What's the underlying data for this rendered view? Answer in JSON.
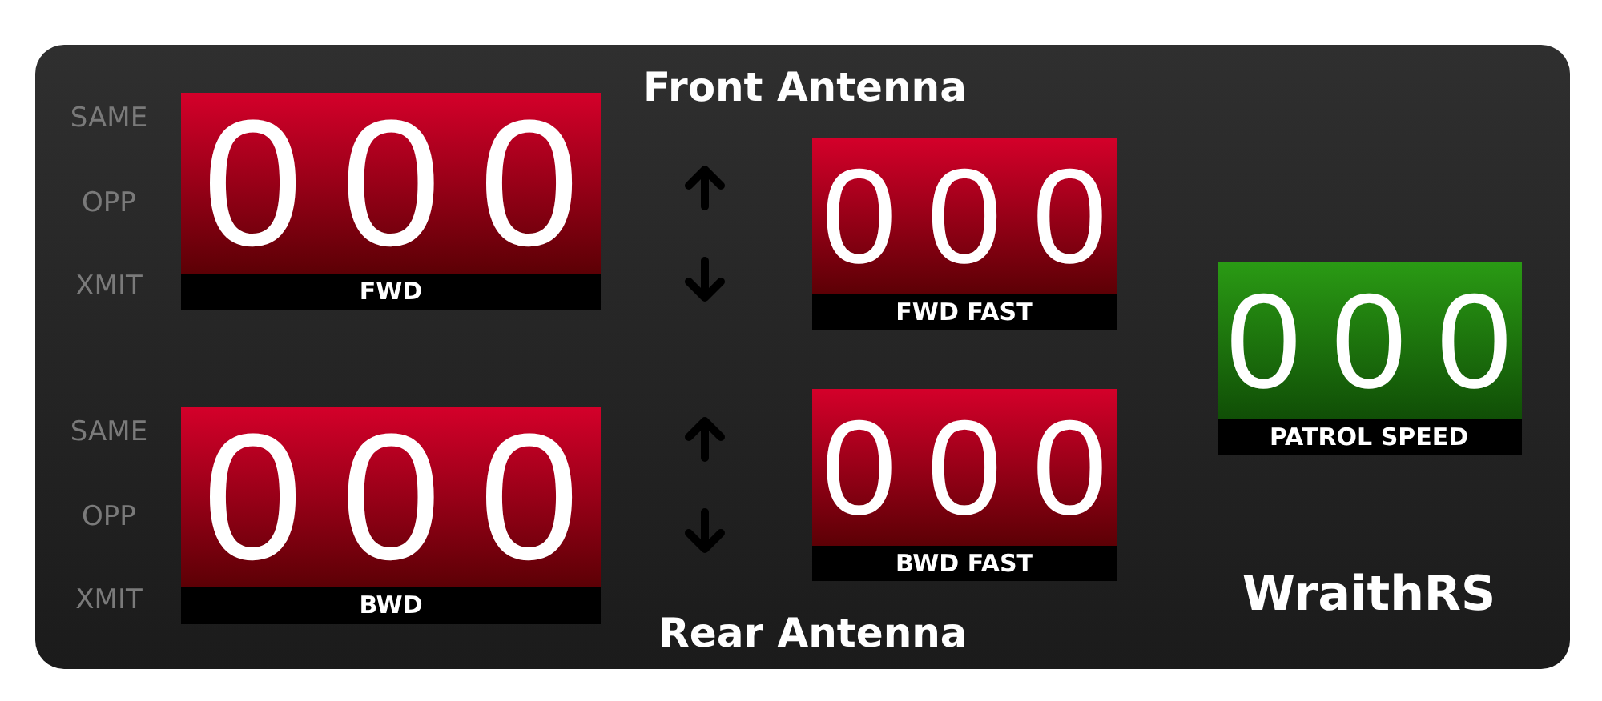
{
  "antennas": [
    {
      "title": "Front Antenna",
      "modes": [
        {
          "label": "SAME",
          "lit": false
        },
        {
          "label": "OPP",
          "lit": false
        },
        {
          "label": "XMIT",
          "lit": false
        }
      ],
      "target": {
        "reading": "000",
        "label": "FWD"
      },
      "arrows": {
        "up_lit": false,
        "down_lit": false
      },
      "fast": {
        "reading": "000",
        "label": "FWD FAST"
      }
    },
    {
      "title": "Rear Antenna",
      "modes": [
        {
          "label": "SAME",
          "lit": false
        },
        {
          "label": "OPP",
          "lit": false
        },
        {
          "label": "XMIT",
          "lit": false
        }
      ],
      "target": {
        "reading": "000",
        "label": "BWD"
      },
      "arrows": {
        "up_lit": false,
        "down_lit": false
      },
      "fast": {
        "reading": "000",
        "label": "BWD FAST"
      }
    }
  ],
  "patrol": {
    "reading": "000",
    "label": "PATROL SPEED"
  },
  "brand": "WraithRS"
}
